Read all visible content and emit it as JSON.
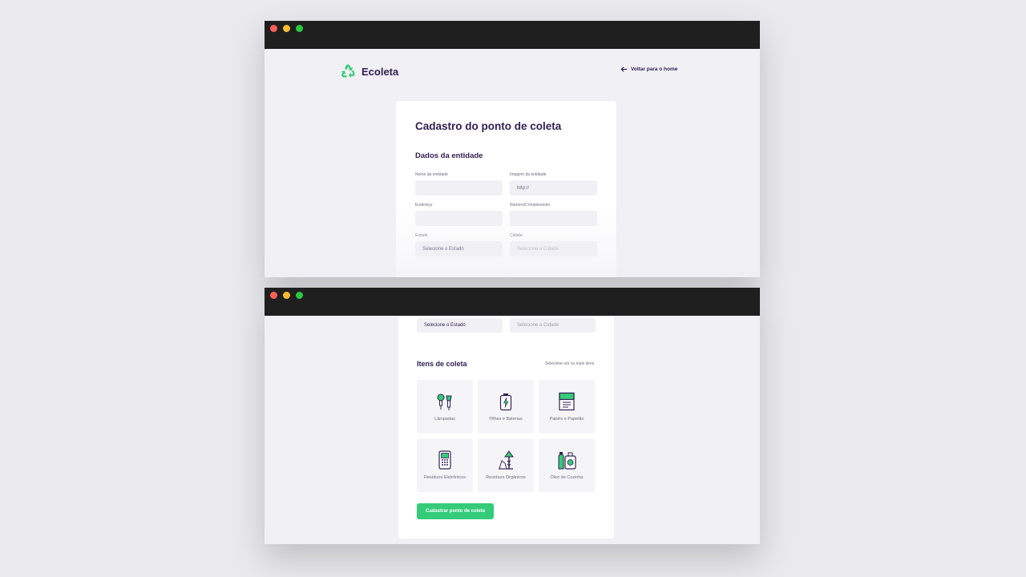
{
  "header": {
    "app_name": "Ecoleta",
    "back_link": "Voltar para o home"
  },
  "form": {
    "title": "Cadastro do ponto de coleta",
    "section_entity": "Dados da entidade",
    "fields": {
      "name_label": "Nome da entidade",
      "image_label": "Imagem da entidade",
      "image_placeholder": "http://",
      "address_label": "Endereço",
      "number_label": "Número/Complemento",
      "state_label": "Estado",
      "state_value": "Selecione o Estado",
      "city_label": "Cidade",
      "city_placeholder": "Selecione a Cidade"
    },
    "items_section": {
      "title": "Itens de coleta",
      "hint": "Selecione um ou mais itens",
      "items": [
        {
          "label": "Lâmpadas",
          "icon": "lightbulb-icon"
        },
        {
          "label": "Pilhas e Baterias",
          "icon": "battery-icon"
        },
        {
          "label": "Papéis e Papelão",
          "icon": "paper-icon"
        },
        {
          "label": "Resíduos Eletrônicos",
          "icon": "electronics-icon"
        },
        {
          "label": "Resíduos Orgânicos",
          "icon": "organic-icon"
        },
        {
          "label": "Óleo de Cozinha",
          "icon": "oil-icon"
        }
      ]
    },
    "submit_label": "Cadastrar ponto de coleta"
  },
  "colors": {
    "primary": "#34cb79",
    "title": "#322153",
    "text": "#6c6c80",
    "background": "#f0f0f5"
  }
}
